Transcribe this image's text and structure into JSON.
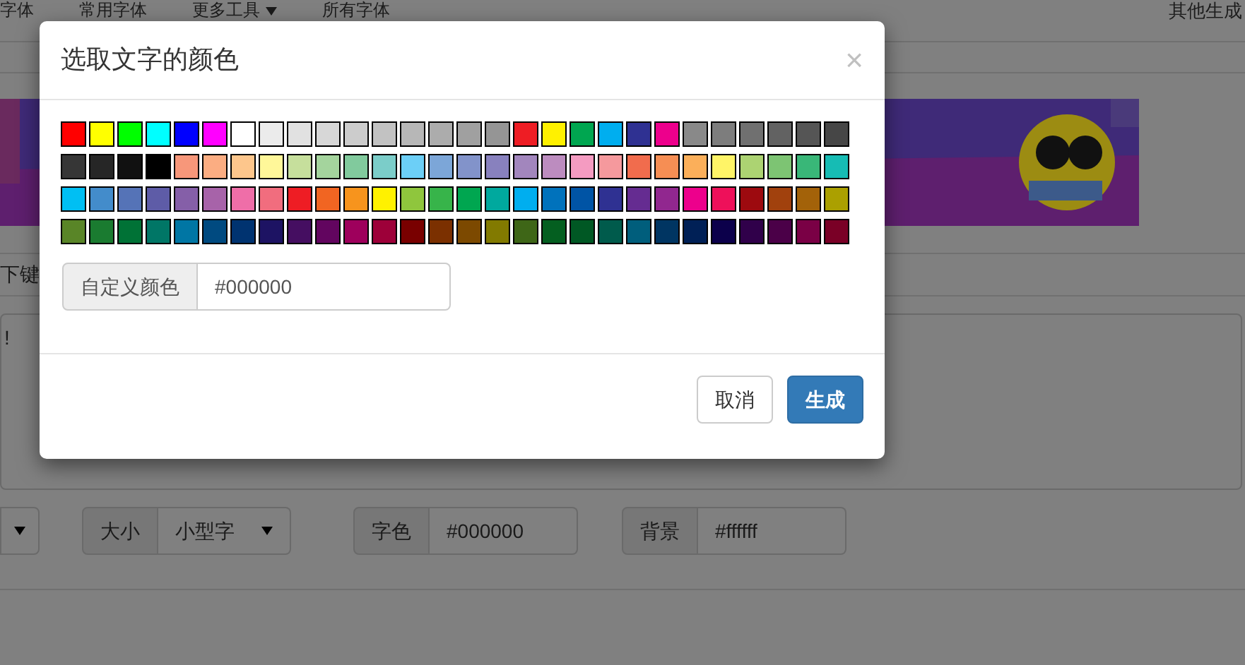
{
  "background": {
    "nav": [
      {
        "label": "字体",
        "dropdown": false
      },
      {
        "label": "常用字体",
        "dropdown": false
      },
      {
        "label": "更多工具",
        "dropdown": true
      },
      {
        "label": "所有字体",
        "dropdown": false
      }
    ],
    "nav_right": "其他生成",
    "hint": "下键",
    "textarea_value": "!",
    "controls": [
      {
        "kind": "select"
      },
      {
        "kind": "select",
        "label": "大小",
        "value": "小型字"
      },
      {
        "kind": "input",
        "label": "字色",
        "value": "#000000"
      },
      {
        "kind": "input",
        "label": "背景",
        "value": "#ffffff"
      }
    ]
  },
  "dialog": {
    "title": "选取文字的颜色",
    "close": "×",
    "swatch_rows": [
      [
        {
          "color": "#ff0000"
        },
        {
          "color": "#ffff00"
        },
        {
          "color": "#00ff00"
        },
        {
          "color": "#00ffff"
        },
        {
          "color": "#0000ff"
        },
        {
          "color": "#ff00ff"
        },
        {
          "color": "#ffffff"
        },
        {
          "color": "#ebebeb"
        },
        {
          "color": "#e1e1e1"
        },
        {
          "color": "#d7d7d7"
        },
        {
          "color": "#cccccc"
        },
        {
          "color": "#c2c2c2"
        },
        {
          "color": "#b7b7b7"
        },
        {
          "color": "#acacac"
        },
        {
          "color": "#a0a0a0"
        },
        {
          "color": "#959595"
        },
        {
          "color": "#ee1d24"
        },
        {
          "color": "#fff100"
        },
        {
          "color": "#00a650"
        },
        {
          "color": "#00aeef"
        },
        {
          "color": "#2f3192"
        },
        {
          "color": "#ed008c"
        },
        {
          "color": "#898989"
        },
        {
          "color": "#7d7d7d"
        },
        {
          "color": "#707070"
        },
        {
          "color": "#626262"
        },
        {
          "color": "#555555"
        },
        {
          "color": "#464646"
        }
      ],
      [
        {
          "color": "#363636"
        },
        {
          "color": "#262626"
        },
        {
          "color": "#111111"
        },
        {
          "color": "#000000"
        },
        {
          "color": "#f7977a"
        },
        {
          "color": "#fbad82"
        },
        {
          "color": "#fdc68c"
        },
        {
          "color": "#fff799"
        },
        {
          "color": "#c6df9c"
        },
        {
          "color": "#a4d49d"
        },
        {
          "color": "#81ca9d"
        },
        {
          "color": "#7bcdc9"
        },
        {
          "color": "#6ccff7"
        },
        {
          "color": "#7ca6d8"
        },
        {
          "color": "#8293ca"
        },
        {
          "color": "#8881be"
        },
        {
          "color": "#a286bd"
        },
        {
          "color": "#bc8cbf"
        },
        {
          "color": "#f49bc1"
        },
        {
          "color": "#f5999d"
        },
        {
          "color": "#f16c4d"
        },
        {
          "color": "#f68e54"
        },
        {
          "color": "#fbaf5a"
        },
        {
          "color": "#fff467"
        },
        {
          "color": "#acd372"
        },
        {
          "color": "#7dc473"
        },
        {
          "color": "#39b778"
        },
        {
          "color": "#16bcb4"
        }
      ],
      [
        {
          "color": "#00bff3"
        },
        {
          "color": "#438ccb"
        },
        {
          "color": "#5573b7"
        },
        {
          "color": "#5e5ca7"
        },
        {
          "color": "#855fa8"
        },
        {
          "color": "#a763a9"
        },
        {
          "color": "#ef6ea8"
        },
        {
          "color": "#f16d7e"
        },
        {
          "color": "#ee1d24"
        },
        {
          "color": "#f16522"
        },
        {
          "color": "#f7941d"
        },
        {
          "color": "#fff100"
        },
        {
          "color": "#8fc63d"
        },
        {
          "color": "#37b44a"
        },
        {
          "color": "#00a650"
        },
        {
          "color": "#00a99e"
        },
        {
          "color": "#00aeef"
        },
        {
          "color": "#0072bc"
        },
        {
          "color": "#0054a5"
        },
        {
          "color": "#2f3192"
        },
        {
          "color": "#652c91"
        },
        {
          "color": "#91278f"
        },
        {
          "color": "#ed008c"
        },
        {
          "color": "#ee105a"
        },
        {
          "color": "#9d0a0f"
        },
        {
          "color": "#a1410d"
        },
        {
          "color": "#a36209"
        },
        {
          "color": "#aba000"
        }
      ],
      [
        {
          "color": "#598527"
        },
        {
          "color": "#1a7b30"
        },
        {
          "color": "#007236"
        },
        {
          "color": "#007666"
        },
        {
          "color": "#0076a4"
        },
        {
          "color": "#004a80"
        },
        {
          "color": "#003370"
        },
        {
          "color": "#1d1363"
        },
        {
          "color": "#450e61"
        },
        {
          "color": "#62055f"
        },
        {
          "color": "#9e005c"
        },
        {
          "color": "#9d0039"
        },
        {
          "color": "#790000"
        },
        {
          "color": "#7b3000"
        },
        {
          "color": "#7c4900"
        },
        {
          "color": "#827a00"
        },
        {
          "color": "#3e6617"
        },
        {
          "color": "#045f20"
        },
        {
          "color": "#005824"
        },
        {
          "color": "#005b4c"
        },
        {
          "color": "#005e7c"
        },
        {
          "color": "#003562"
        },
        {
          "color": "#002056"
        },
        {
          "color": "#0c004b"
        },
        {
          "color": "#30004a"
        },
        {
          "color": "#4b0048"
        },
        {
          "color": "#7a0045"
        },
        {
          "color": "#7a0026"
        }
      ]
    ],
    "custom": {
      "label": "自定义颜色",
      "value": "#000000"
    },
    "buttons": [
      {
        "label": "取消",
        "kind": "default"
      },
      {
        "label": "生成",
        "kind": "primary"
      }
    ]
  }
}
